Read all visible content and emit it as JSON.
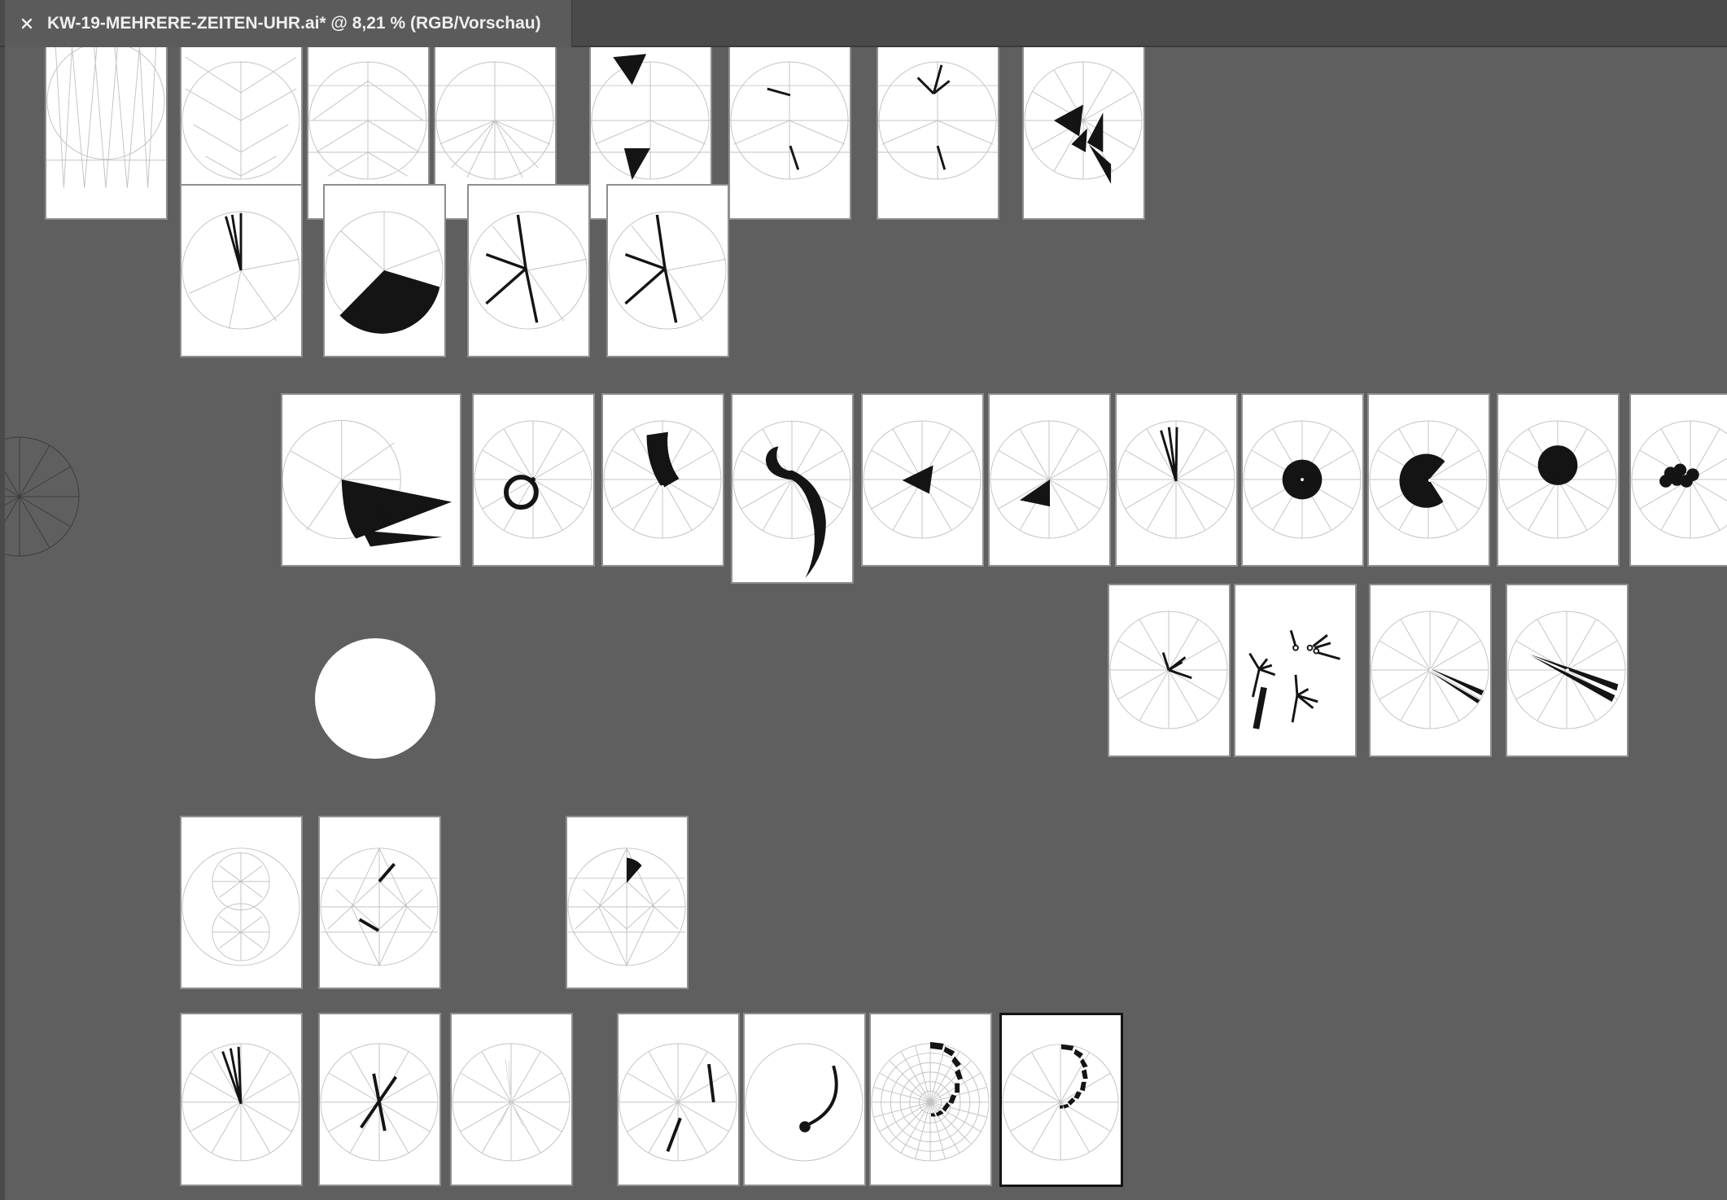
{
  "document_tab": {
    "title": "KW-19-MEHRERE-ZEITEN-UHR.ai* @ 8,21 % (RGB/Vorschau)",
    "close_icon": "close-icon"
  },
  "canvas": {
    "background_color": "#5f5f5f",
    "artboard_color": "#ffffff",
    "artwork_color": "#141414",
    "guide_color": "#c3c3c3",
    "artboard_count": 43,
    "selected_artboard": "bottom row, last artboard (spiral steps)"
  }
}
